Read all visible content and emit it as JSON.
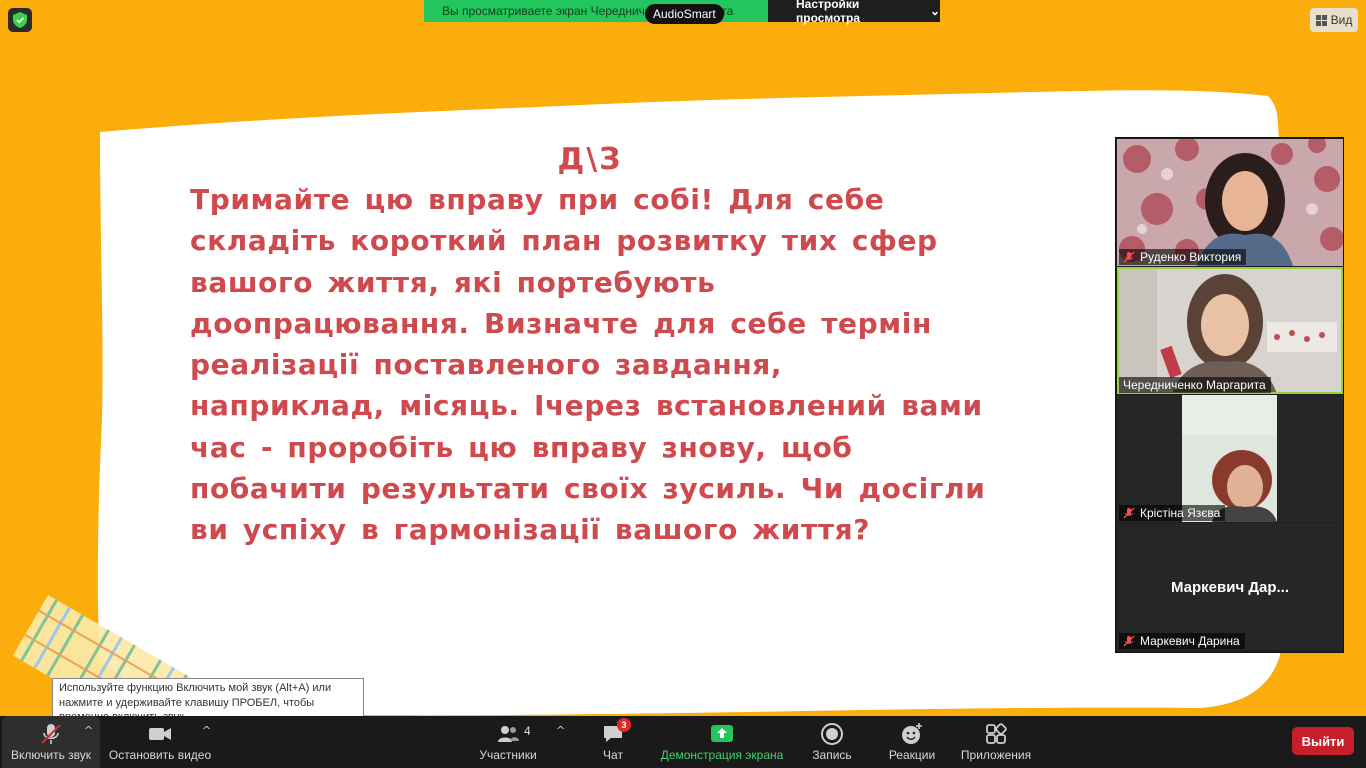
{
  "banner": {
    "sharing_text": "Вы просматриваете экран Чередниченко Маргарита",
    "audio_badge": "AudioSmart",
    "view_settings": "Настройки просмотра",
    "view_button": "Вид"
  },
  "slide": {
    "title": "Д\\З",
    "body": "Тримайте цю вправу при собі! Для себе складіть короткий план розвитку тих сфер вашого життя, які портебують доопрацювання. Визначте для себе термін реалізації поставленого завдання, наприклад, місяць. Ічерез встановлений вами час - проробіть цю вправу знову, щоб побачити результати своїх зусиль. Чи досігли ви успіху в гармонізації вашого життя?",
    "colors": {
      "background": "#fbad0b",
      "paper": "#ffffff",
      "text": "#cf4a4f"
    }
  },
  "participants": [
    {
      "name": "Руденко  Виктория",
      "muted": true,
      "video": true,
      "active": false
    },
    {
      "name": "Чередниченко Маргарита",
      "muted": false,
      "video": true,
      "active": true
    },
    {
      "name": "Крістіна Язєва",
      "muted": true,
      "video": true,
      "active": false
    },
    {
      "name": "Маркевич Дарина",
      "display_name": "Маркевич  Дар...",
      "muted": true,
      "video": false,
      "active": false
    }
  ],
  "tooltip": {
    "text": "Используйте функцию Включить мой звук (Alt+A) или нажмите и удерживайте клавишу ПРОБЕЛ, чтобы временно включить звук."
  },
  "toolbar": {
    "unmute": "Включить звук",
    "stop_video": "Остановить видео",
    "participants": "Участники",
    "participants_count": "4",
    "chat": "Чат",
    "chat_badge": "3",
    "share": "Демонстрация экрана",
    "record": "Запись",
    "reactions": "Реакции",
    "apps": "Приложения",
    "leave": "Выйти",
    "colors": {
      "bar": "#1a1a1a",
      "share": "#3fd36a",
      "leave": "#c5202a"
    }
  }
}
